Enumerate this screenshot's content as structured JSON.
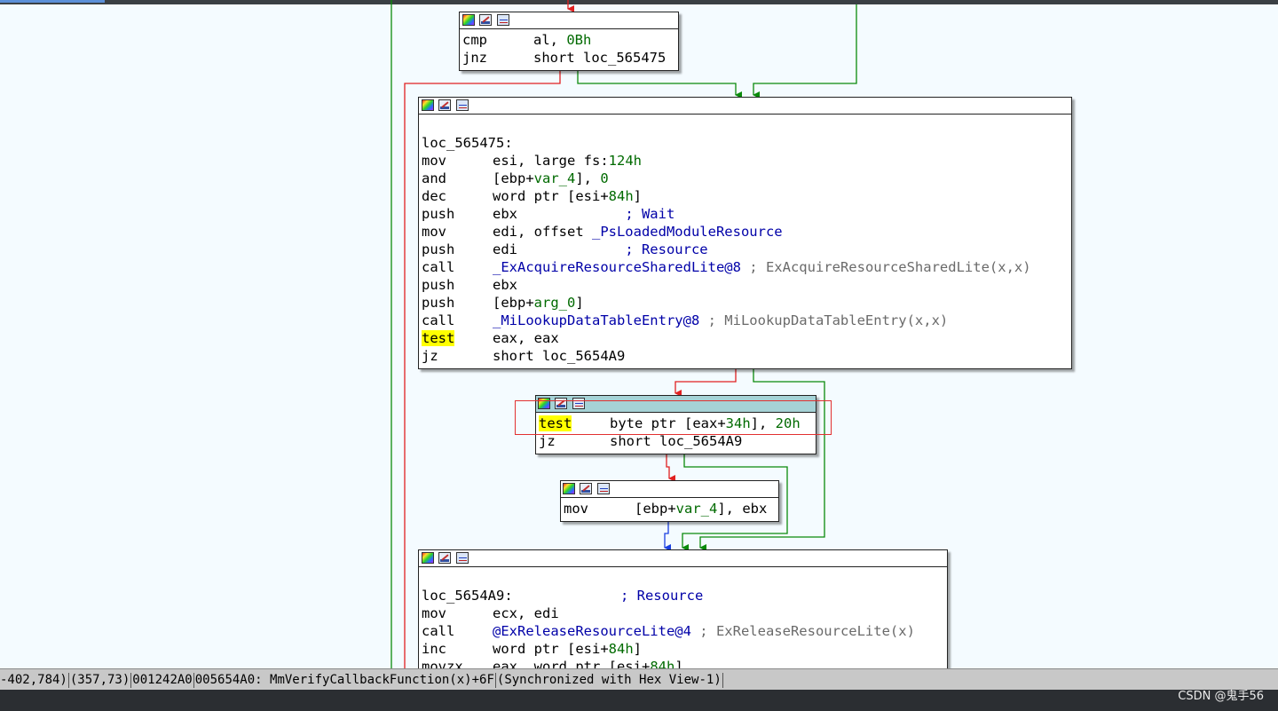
{
  "nodes": [
    {
      "name": "block-cmp-al",
      "lines": [
        {
          "mnem": "cmp",
          "ops": [
            [
              "op",
              "al, "
            ],
            [
              "g",
              "0Bh"
            ]
          ]
        },
        {
          "mnem": "jnz",
          "ops": [
            [
              "op",
              "short loc_565475"
            ]
          ]
        }
      ]
    },
    {
      "name": "block-loc-565475",
      "lines": [
        {
          "mnem": "",
          "ops": []
        },
        {
          "label": "loc_565475:"
        },
        {
          "mnem": "mov",
          "ops": [
            [
              "op",
              "esi, large fs:"
            ],
            [
              "g",
              "124h"
            ]
          ]
        },
        {
          "mnem": "and",
          "ops": [
            [
              "op",
              "[ebp+"
            ],
            [
              "g",
              "var_4"
            ],
            [
              "op",
              "], "
            ],
            [
              "g",
              "0"
            ]
          ]
        },
        {
          "mnem": "dec",
          "ops": [
            [
              "op",
              "word ptr [esi+"
            ],
            [
              "g",
              "84h"
            ],
            [
              "op",
              "]"
            ]
          ]
        },
        {
          "mnem": "push",
          "ops": [
            [
              "op",
              "ebx             "
            ],
            [
              "b",
              "; Wait"
            ]
          ]
        },
        {
          "mnem": "mov",
          "ops": [
            [
              "op",
              "edi, offset "
            ],
            [
              "b",
              "_PsLoadedModuleResource"
            ]
          ]
        },
        {
          "mnem": "push",
          "ops": [
            [
              "op",
              "edi             "
            ],
            [
              "b",
              "; Resource"
            ]
          ]
        },
        {
          "mnem": "call",
          "ops": [
            [
              "b",
              "_ExAcquireResourceSharedLite@8"
            ],
            [
              "cm",
              " ; ExAcquireResourceSharedLite(x,x)"
            ]
          ]
        },
        {
          "mnem": "push",
          "ops": [
            [
              "op",
              "ebx"
            ]
          ]
        },
        {
          "mnem": "push",
          "ops": [
            [
              "op",
              "[ebp+"
            ],
            [
              "g",
              "arg_0"
            ],
            [
              "op",
              "]"
            ]
          ]
        },
        {
          "mnem": "call",
          "ops": [
            [
              "b",
              "_MiLookupDataTableEntry@8"
            ],
            [
              "cm",
              " ; MiLookupDataTableEntry(x,x)"
            ]
          ]
        },
        {
          "mnem": "test",
          "hl": true,
          "ops": [
            [
              "op",
              "eax, eax"
            ]
          ]
        },
        {
          "mnem": "jz",
          "ops": [
            [
              "op",
              "short loc_5654A9"
            ]
          ]
        }
      ]
    },
    {
      "name": "block-test-byte",
      "lines": [
        {
          "mnem": "test",
          "hl": true,
          "ops": [
            [
              "op",
              "byte ptr [eax+"
            ],
            [
              "g",
              "34h"
            ],
            [
              "op",
              "], "
            ],
            [
              "g",
              "20h"
            ]
          ]
        },
        {
          "mnem": "jz",
          "ops": [
            [
              "op",
              "short loc_5654A9"
            ]
          ]
        }
      ]
    },
    {
      "name": "block-mov-var4",
      "lines": [
        {
          "mnem": "mov",
          "ops": [
            [
              "op",
              "[ebp+"
            ],
            [
              "g",
              "var_4"
            ],
            [
              "op",
              "], ebx"
            ]
          ]
        }
      ]
    },
    {
      "name": "block-loc-5654a9",
      "lines": [
        {
          "mnem": "",
          "ops": []
        },
        {
          "label": "loc_5654A9:",
          "tail": [
            [
              "op",
              "             "
            ],
            [
              "b",
              "; Resource"
            ]
          ]
        },
        {
          "mnem": "mov",
          "ops": [
            [
              "op",
              "ecx, edi"
            ]
          ]
        },
        {
          "mnem": "call",
          "ops": [
            [
              "b",
              "@ExReleaseResourceLite@4"
            ],
            [
              "cm",
              " ; ExReleaseResourceLite(x)"
            ]
          ]
        },
        {
          "mnem": "inc",
          "ops": [
            [
              "op",
              "word ptr [esi+"
            ],
            [
              "g",
              "84h"
            ],
            [
              "op",
              "]"
            ]
          ]
        },
        {
          "mnem": "movzx",
          "ops": [
            [
              "op",
              "eax, word ptr [esi+"
            ],
            [
              "g",
              "84h"
            ],
            [
              "op",
              "]"
            ]
          ]
        }
      ]
    }
  ],
  "status": {
    "coords": "-402,784)",
    "pos": "(357,73)",
    "offset": "001242A0",
    "address": "005654A0: MmVerifyCallbackFunction(x)+6F",
    "sync": "(Synchronized with Hex View-1)"
  },
  "watermark": "CSDN @鬼手56",
  "colors": {
    "edge_true": "#0a8a0a",
    "edge_false": "#e02020",
    "edge_uncond": "#1a3fe0",
    "selected_header": "#a6d2d6"
  }
}
